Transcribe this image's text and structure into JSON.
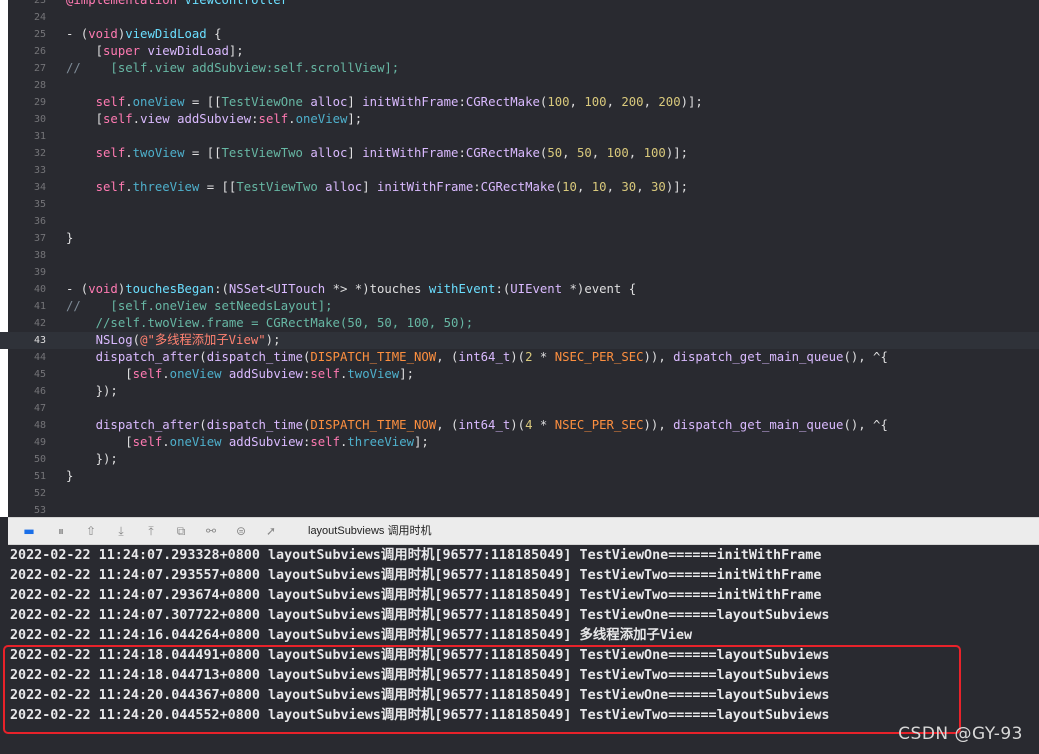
{
  "editor": {
    "lines": [
      {
        "num": "23",
        "tokens": [
          [
            "kw",
            "@implementation"
          ],
          [
            "plain",
            " "
          ],
          [
            "ty",
            "ViewController"
          ]
        ]
      },
      {
        "num": "24",
        "tokens": []
      },
      {
        "num": "25",
        "tokens": [
          [
            "plain",
            "- ("
          ],
          [
            "kw",
            "void"
          ],
          [
            "plain",
            ")"
          ],
          [
            "ty",
            "viewDidLoad"
          ],
          [
            "plain",
            " {"
          ]
        ]
      },
      {
        "num": "26",
        "tokens": [
          [
            "plain",
            "    ["
          ],
          [
            "kw",
            "super"
          ],
          [
            "plain",
            " "
          ],
          [
            "lib",
            "viewDidLoad"
          ],
          [
            "plain",
            "];"
          ]
        ]
      },
      {
        "num": "27",
        "tokens": [
          [
            "cm",
            "//    "
          ],
          [
            "fn",
            "[self.view addSubview:self.scrollView];"
          ]
        ]
      },
      {
        "num": "28",
        "tokens": []
      },
      {
        "num": "29",
        "tokens": [
          [
            "plain",
            "    "
          ],
          [
            "kw",
            "self"
          ],
          [
            "plain",
            "."
          ],
          [
            "prop",
            "oneView"
          ],
          [
            "plain",
            " = [["
          ],
          [
            "fn",
            "TestViewOne"
          ],
          [
            "plain",
            " "
          ],
          [
            "lib",
            "alloc"
          ],
          [
            "plain",
            "] "
          ],
          [
            "lib",
            "initWithFrame"
          ],
          [
            "plain",
            ":"
          ],
          [
            "lib",
            "CGRectMake"
          ],
          [
            "plain",
            "("
          ],
          [
            "num",
            "100"
          ],
          [
            "plain",
            ", "
          ],
          [
            "num",
            "100"
          ],
          [
            "plain",
            ", "
          ],
          [
            "num",
            "200"
          ],
          [
            "plain",
            ", "
          ],
          [
            "num",
            "200"
          ],
          [
            "plain",
            ")];"
          ]
        ]
      },
      {
        "num": "30",
        "tokens": [
          [
            "plain",
            "    ["
          ],
          [
            "kw",
            "self"
          ],
          [
            "plain",
            "."
          ],
          [
            "lib",
            "view"
          ],
          [
            "plain",
            " "
          ],
          [
            "lib",
            "addSubview"
          ],
          [
            "plain",
            ":"
          ],
          [
            "kw",
            "self"
          ],
          [
            "plain",
            "."
          ],
          [
            "prop",
            "oneView"
          ],
          [
            "plain",
            "];"
          ]
        ]
      },
      {
        "num": "31",
        "tokens": []
      },
      {
        "num": "32",
        "tokens": [
          [
            "plain",
            "    "
          ],
          [
            "kw",
            "self"
          ],
          [
            "plain",
            "."
          ],
          [
            "prop",
            "twoView"
          ],
          [
            "plain",
            " = [["
          ],
          [
            "fn",
            "TestViewTwo"
          ],
          [
            "plain",
            " "
          ],
          [
            "lib",
            "alloc"
          ],
          [
            "plain",
            "] "
          ],
          [
            "lib",
            "initWithFrame"
          ],
          [
            "plain",
            ":"
          ],
          [
            "lib",
            "CGRectMake"
          ],
          [
            "plain",
            "("
          ],
          [
            "num",
            "50"
          ],
          [
            "plain",
            ", "
          ],
          [
            "num",
            "50"
          ],
          [
            "plain",
            ", "
          ],
          [
            "num",
            "100"
          ],
          [
            "plain",
            ", "
          ],
          [
            "num",
            "100"
          ],
          [
            "plain",
            ")];"
          ]
        ]
      },
      {
        "num": "33",
        "tokens": []
      },
      {
        "num": "34",
        "tokens": [
          [
            "plain",
            "    "
          ],
          [
            "kw",
            "self"
          ],
          [
            "plain",
            "."
          ],
          [
            "prop",
            "threeView"
          ],
          [
            "plain",
            " = [["
          ],
          [
            "fn",
            "TestViewTwo"
          ],
          [
            "plain",
            " "
          ],
          [
            "lib",
            "alloc"
          ],
          [
            "plain",
            "] "
          ],
          [
            "lib",
            "initWithFrame"
          ],
          [
            "plain",
            ":"
          ],
          [
            "lib",
            "CGRectMake"
          ],
          [
            "plain",
            "("
          ],
          [
            "num",
            "10"
          ],
          [
            "plain",
            ", "
          ],
          [
            "num",
            "10"
          ],
          [
            "plain",
            ", "
          ],
          [
            "num",
            "30"
          ],
          [
            "plain",
            ", "
          ],
          [
            "num",
            "30"
          ],
          [
            "plain",
            ")];"
          ]
        ]
      },
      {
        "num": "35",
        "tokens": []
      },
      {
        "num": "36",
        "tokens": []
      },
      {
        "num": "37",
        "tokens": [
          [
            "plain",
            "}"
          ]
        ]
      },
      {
        "num": "38",
        "tokens": []
      },
      {
        "num": "39",
        "tokens": []
      },
      {
        "num": "40",
        "tokens": [
          [
            "plain",
            "- ("
          ],
          [
            "kw",
            "void"
          ],
          [
            "plain",
            ")"
          ],
          [
            "ty",
            "touchesBegan"
          ],
          [
            "plain",
            ":("
          ],
          [
            "lib",
            "NSSet"
          ],
          [
            "plain",
            "<"
          ],
          [
            "lib",
            "UITouch"
          ],
          [
            "plain",
            " *> *)touches "
          ],
          [
            "ty",
            "withEvent"
          ],
          [
            "plain",
            ":("
          ],
          [
            "lib",
            "UIEvent"
          ],
          [
            "plain",
            " *)event {"
          ]
        ]
      },
      {
        "num": "41",
        "tokens": [
          [
            "cm",
            "//    "
          ],
          [
            "fn",
            "[self.oneView setNeedsLayout];"
          ]
        ]
      },
      {
        "num": "42",
        "tokens": [
          [
            "plain",
            "    "
          ],
          [
            "fn",
            "//self.twoView.frame = CGRectMake(50, 50, 100, 50);"
          ]
        ]
      },
      {
        "num": "43",
        "current": true,
        "tokens": [
          [
            "plain",
            "    "
          ],
          [
            "lib",
            "NSLog"
          ],
          [
            "plain",
            "("
          ],
          [
            "str",
            "@\"多线程添加子View\""
          ],
          [
            "plain",
            ");"
          ]
        ]
      },
      {
        "num": "44",
        "tokens": [
          [
            "plain",
            "    "
          ],
          [
            "lib",
            "dispatch_after"
          ],
          [
            "plain",
            "("
          ],
          [
            "lib",
            "dispatch_time"
          ],
          [
            "plain",
            "("
          ],
          [
            "mac",
            "DISPATCH_TIME_NOW"
          ],
          [
            "plain",
            ", ("
          ],
          [
            "lib",
            "int64_t"
          ],
          [
            "plain",
            ")("
          ],
          [
            "num",
            "2"
          ],
          [
            "plain",
            " * "
          ],
          [
            "mac",
            "NSEC_PER_SEC"
          ],
          [
            "plain",
            ")), "
          ],
          [
            "lib",
            "dispatch_get_main_queue"
          ],
          [
            "plain",
            "(), ^{"
          ]
        ]
      },
      {
        "num": "45",
        "tokens": [
          [
            "plain",
            "        ["
          ],
          [
            "kw",
            "self"
          ],
          [
            "plain",
            "."
          ],
          [
            "prop",
            "oneView"
          ],
          [
            "plain",
            " "
          ],
          [
            "lib",
            "addSubview"
          ],
          [
            "plain",
            ":"
          ],
          [
            "kw",
            "self"
          ],
          [
            "plain",
            "."
          ],
          [
            "prop",
            "twoView"
          ],
          [
            "plain",
            "];"
          ]
        ]
      },
      {
        "num": "46",
        "tokens": [
          [
            "plain",
            "    });"
          ]
        ]
      },
      {
        "num": "47",
        "tokens": []
      },
      {
        "num": "48",
        "tokens": [
          [
            "plain",
            "    "
          ],
          [
            "lib",
            "dispatch_after"
          ],
          [
            "plain",
            "("
          ],
          [
            "lib",
            "dispatch_time"
          ],
          [
            "plain",
            "("
          ],
          [
            "mac",
            "DISPATCH_TIME_NOW"
          ],
          [
            "plain",
            ", ("
          ],
          [
            "lib",
            "int64_t"
          ],
          [
            "plain",
            ")("
          ],
          [
            "num",
            "4"
          ],
          [
            "plain",
            " * "
          ],
          [
            "mac",
            "NSEC_PER_SEC"
          ],
          [
            "plain",
            ")), "
          ],
          [
            "lib",
            "dispatch_get_main_queue"
          ],
          [
            "plain",
            "(), ^{"
          ]
        ]
      },
      {
        "num": "49",
        "tokens": [
          [
            "plain",
            "        ["
          ],
          [
            "kw",
            "self"
          ],
          [
            "plain",
            "."
          ],
          [
            "prop",
            "oneView"
          ],
          [
            "plain",
            " "
          ],
          [
            "lib",
            "addSubview"
          ],
          [
            "plain",
            ":"
          ],
          [
            "kw",
            "self"
          ],
          [
            "plain",
            "."
          ],
          [
            "prop",
            "threeView"
          ],
          [
            "plain",
            "];"
          ]
        ]
      },
      {
        "num": "50",
        "tokens": [
          [
            "plain",
            "    });"
          ]
        ]
      },
      {
        "num": "51",
        "tokens": [
          [
            "plain",
            "}"
          ]
        ]
      },
      {
        "num": "52",
        "tokens": []
      },
      {
        "num": "53",
        "tokens": []
      }
    ]
  },
  "debug_bar": {
    "thread_label": "layoutSubviews 调用时机",
    "buttons": [
      {
        "name": "breakpoints-toggle-icon",
        "glyph": "▬"
      },
      {
        "name": "pause-icon",
        "glyph": "⏸"
      },
      {
        "name": "step-over-icon",
        "glyph": "⇧"
      },
      {
        "name": "step-into-icon",
        "glyph": "⤓"
      },
      {
        "name": "step-out-icon",
        "glyph": "⤒"
      },
      {
        "name": "view-hierarchy-icon",
        "glyph": "⧉"
      },
      {
        "name": "memory-graph-icon",
        "glyph": "⚯"
      },
      {
        "name": "environment-overrides-icon",
        "glyph": "⊜"
      },
      {
        "name": "simulate-location-icon",
        "glyph": "➚"
      }
    ]
  },
  "console": {
    "lines": [
      "2022-02-22 11:24:07.293328+0800 layoutSubviews调用时机[96577:118185049] TestViewOne======initWithFrame",
      "2022-02-22 11:24:07.293557+0800 layoutSubviews调用时机[96577:118185049] TestViewTwo======initWithFrame",
      "2022-02-22 11:24:07.293674+0800 layoutSubviews调用时机[96577:118185049] TestViewTwo======initWithFrame",
      "2022-02-22 11:24:07.307722+0800 layoutSubviews调用时机[96577:118185049] TestViewOne======layoutSubviews",
      "2022-02-22 11:24:16.044264+0800 layoutSubviews调用时机[96577:118185049] 多线程添加子View",
      "2022-02-22 11:24:18.044491+0800 layoutSubviews调用时机[96577:118185049] TestViewOne======layoutSubviews",
      "2022-02-22 11:24:18.044713+0800 layoutSubviews调用时机[96577:118185049] TestViewTwo======layoutSubviews",
      "2022-02-22 11:24:20.044367+0800 layoutSubviews调用时机[96577:118185049] TestViewOne======layoutSubviews",
      "2022-02-22 11:24:20.044552+0800 layoutSubviews调用时机[96577:118185049] TestViewTwo======layoutSubviews"
    ]
  },
  "watermark": "CSDN @GY-93",
  "colors": {
    "editor_bg": "#292a30",
    "highlight_border": "#e8222a",
    "active_button": "#1a6fe8"
  }
}
